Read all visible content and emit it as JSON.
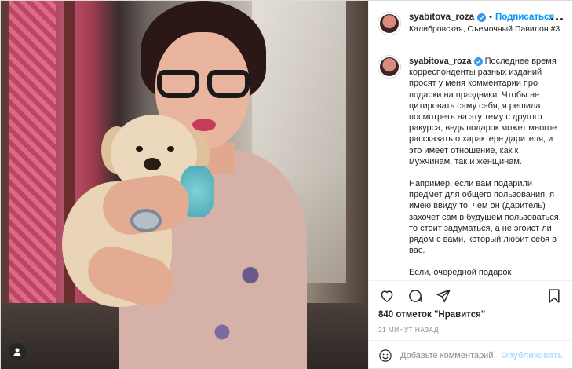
{
  "post": {
    "username": "syabitova_roza",
    "follow_label": "Подписаться",
    "separator": "•",
    "location": "Калибровская, Съемочный Павилон #3"
  },
  "caption": {
    "paragraphs": [
      "Последнее время корреспонденты разных изданий просят у меня комментарии про подарки на праздники. Чтобы не цитировать саму себя, я решила посмотреть на эту тему с другого ракурса, ведь подарок может многое рассказать о характере дарителя, и это имеет отношение, как к мужчинам, так и женщинам.",
      "Например, если вам подарили предмет для общего пользования, я имею ввиду то, чем он (даритель) захочет сам в будущем пользоваться, то стоит задуматься, а не эгоист ли рядом с вами, который любит себя в вас.",
      "Если, очередной подарок"
    ]
  },
  "actions": {
    "like_icon": "heart-icon",
    "comment_icon": "comment-icon",
    "share_icon": "share-icon",
    "save_icon": "bookmark-icon"
  },
  "likes": "840 отметок \"Нравится\"",
  "timestamp": "21 МИНУТ НАЗАД",
  "comment": {
    "placeholder": "Добавьте комментарий...",
    "publish_label": "Опубликовать"
  },
  "colors": {
    "accent": "#0095f6",
    "verified": "#3897f0",
    "publish_disabled": "#b2dffc",
    "muted": "#8e8e8e"
  }
}
